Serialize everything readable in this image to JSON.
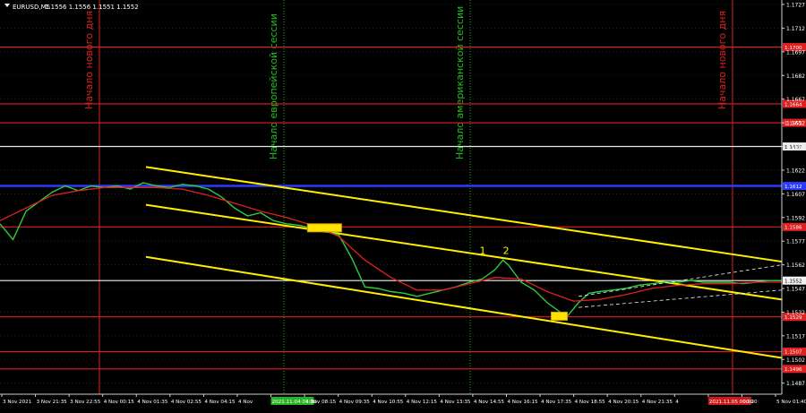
{
  "chart_data": {
    "type": "line",
    "symbol": "EURUSD,M5",
    "ohlc": "1.1556 1.1556 1.1551 1.1552",
    "ylim": [
      1.148,
      1.1727
    ],
    "y_ticks": [
      "1.1727",
      "1.1712",
      "1.1697",
      "1.1682",
      "1.1667",
      "1.1652",
      "1.1637",
      "1.1622",
      "1.1607",
      "1.1592",
      "1.1577",
      "1.1562",
      "1.1547",
      "1.1532",
      "1.1517",
      "1.1502",
      "1.1487"
    ],
    "x_ticks": [
      "3 Nov 2021",
      "3 Nov 21:35",
      "3 Nov 22:55",
      "4 Nov 00:15",
      "4 Nov 01:35",
      "4 Nov 02:55",
      "4 Nov 04:15",
      "4 Nov",
      "2021.11.04 07:00",
      "4 Nov 08:15",
      "4 Nov 09:35",
      "4 Nov 10:55",
      "4 Nov 12:15",
      "4 Nov 13:35",
      "4 Nov 14:55",
      "4 Nov 16:15",
      "4 Nov 17:35",
      "4 Nov 18:55",
      "4 Nov 20:15",
      "4 Nov 21:35",
      "4",
      "2021.11.05 00:00",
      "00:20",
      "5 Nov 01:40"
    ],
    "sessions": [
      {
        "label": "Начало нового дня",
        "color": "#e02020"
      },
      {
        "label": "Начало европейской сессии",
        "color": "#1fc31f"
      },
      {
        "label": "Начало американской сессии",
        "color": "#1fc31f"
      },
      {
        "label": "Начало нового дня",
        "color": "#e02020"
      }
    ],
    "levels": [
      {
        "value": 1.17,
        "label": "1.1700",
        "color": "#e02020"
      },
      {
        "value": 1.1664,
        "label": "1.1664",
        "color": "#e02020"
      },
      {
        "value": 1.1652,
        "label": "1.1652",
        "color": "#e02020"
      },
      {
        "value": 1.1637,
        "label": "1.1637",
        "color": "#e8e8e8"
      },
      {
        "value": 1.1612,
        "label": "1.1612",
        "color": "#2a3aff"
      },
      {
        "value": 1.1586,
        "label": "1.1586",
        "color": "#e02020"
      },
      {
        "value": 1.1552,
        "label": "1.1552",
        "color": "#f2f2f2"
      },
      {
        "value": 1.1529,
        "label": "1.1529",
        "color": "#e02020"
      },
      {
        "value": 1.1507,
        "label": "1.1507",
        "color": "#e02020"
      },
      {
        "value": 1.1496,
        "label": "1.1496",
        "color": "#e02020"
      }
    ],
    "price": [
      [
        0,
        1.1588
      ],
      [
        5,
        1.1578
      ],
      [
        10,
        1.1596
      ],
      [
        15,
        1.1602
      ],
      [
        20,
        1.1608
      ],
      [
        25,
        1.1612
      ],
      [
        30,
        1.1609
      ],
      [
        35,
        1.1612
      ],
      [
        40,
        1.1611
      ],
      [
        45,
        1.1612
      ],
      [
        50,
        1.161
      ],
      [
        55,
        1.1614
      ],
      [
        60,
        1.1612
      ],
      [
        65,
        1.1611
      ],
      [
        70,
        1.1613
      ],
      [
        75,
        1.1612
      ],
      [
        80,
        1.161
      ],
      [
        85,
        1.1605
      ],
      [
        90,
        1.1598
      ],
      [
        95,
        1.1593
      ],
      [
        100,
        1.1595
      ],
      [
        105,
        1.159
      ],
      [
        110,
        1.1588
      ],
      [
        115,
        1.1587
      ],
      [
        120,
        1.1585
      ],
      [
        125,
        1.1583
      ],
      [
        130,
        1.1581
      ],
      [
        135,
        1.1566
      ],
      [
        140,
        1.1548
      ],
      [
        145,
        1.1547
      ],
      [
        150,
        1.1545
      ],
      [
        155,
        1.1544
      ],
      [
        160,
        1.1542
      ],
      [
        165,
        1.1544
      ],
      [
        170,
        1.1546
      ],
      [
        175,
        1.1548
      ],
      [
        180,
        1.1551
      ],
      [
        185,
        1.1553
      ],
      [
        190,
        1.1559
      ],
      [
        193,
        1.1565
      ],
      [
        195,
        1.1562
      ],
      [
        200,
        1.1551
      ],
      [
        205,
        1.1546
      ],
      [
        210,
        1.1538
      ],
      [
        215,
        1.1532
      ],
      [
        218,
        1.153
      ],
      [
        222,
        1.1538
      ],
      [
        226,
        1.1544
      ],
      [
        230,
        1.1545
      ],
      [
        235,
        1.1546
      ],
      [
        240,
        1.1547
      ],
      [
        245,
        1.1549
      ],
      [
        250,
        1.155
      ],
      [
        255,
        1.1551
      ],
      [
        260,
        1.1551
      ],
      [
        265,
        1.1552
      ],
      [
        270,
        1.1551
      ],
      [
        275,
        1.1551
      ],
      [
        280,
        1.1551
      ],
      [
        285,
        1.155
      ],
      [
        290,
        1.1551
      ],
      [
        295,
        1.1552
      ],
      [
        300,
        1.1552
      ]
    ],
    "ma": [
      [
        0,
        1.159
      ],
      [
        10,
        1.1598
      ],
      [
        20,
        1.1606
      ],
      [
        30,
        1.1609
      ],
      [
        40,
        1.1611
      ],
      [
        50,
        1.1611
      ],
      [
        60,
        1.1611
      ],
      [
        70,
        1.161
      ],
      [
        80,
        1.1606
      ],
      [
        90,
        1.1601
      ],
      [
        100,
        1.1596
      ],
      [
        110,
        1.1592
      ],
      [
        120,
        1.1587
      ],
      [
        130,
        1.158
      ],
      [
        140,
        1.1565
      ],
      [
        150,
        1.1554
      ],
      [
        160,
        1.1546
      ],
      [
        170,
        1.1546
      ],
      [
        180,
        1.155
      ],
      [
        190,
        1.1554
      ],
      [
        200,
        1.1553
      ],
      [
        210,
        1.1545
      ],
      [
        220,
        1.1539
      ],
      [
        230,
        1.154
      ],
      [
        240,
        1.1543
      ],
      [
        250,
        1.1547
      ],
      [
        260,
        1.1549
      ],
      [
        270,
        1.155
      ],
      [
        280,
        1.155
      ],
      [
        290,
        1.1551
      ],
      [
        300,
        1.1551
      ]
    ],
    "x_range": [
      0,
      300
    ],
    "channel_lines": [
      {
        "x1": 56,
        "y1": 1.1624,
        "x2": 300,
        "y2": 1.1564
      },
      {
        "x1": 56,
        "y1": 1.16,
        "x2": 300,
        "y2": 1.154
      },
      {
        "x1": 56,
        "y1": 1.1567,
        "x2": 300,
        "y2": 1.1503
      }
    ],
    "annotations": [
      {
        "text": "1",
        "x": 184,
        "y": 1.1569
      },
      {
        "text": "2",
        "x": 193,
        "y": 1.1569
      }
    ]
  }
}
